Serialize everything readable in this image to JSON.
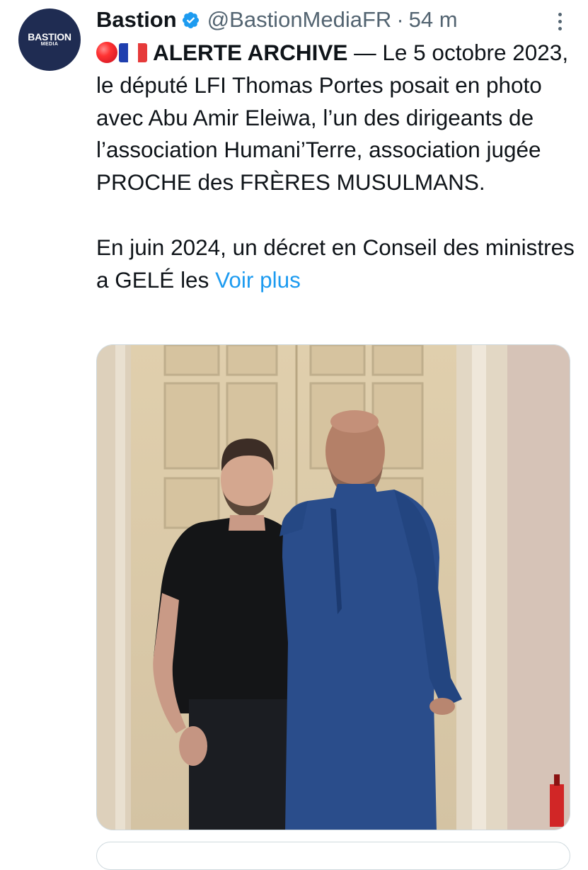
{
  "account": {
    "avatar_line1": "BASTION",
    "avatar_line2": "MEDIA",
    "name": "Bastion",
    "handle": "@BastionMediaFR",
    "separator": "·",
    "time": "54 m"
  },
  "tweet": {
    "headline": "ALERTE ARCHIVE",
    "paragraph1_rest": " — Le 5 octobre 2023, le député LFI Thomas Portes posait en photo avec Abu Amir Eleiwa, l’un des dirigeants de l’association Humani’Terre, association jugée PROCHE des FRÈRES MUSULMANS.",
    "paragraph2": "En juin 2024, un décret en Conseil des ministres a GELÉ les ",
    "show_more": "Voir plus"
  },
  "icons": {
    "verified": "verified-badge-icon",
    "more": "more-options-icon",
    "emoji_1": "red-circle-emoji",
    "emoji_2": "france-flag-emoji"
  },
  "colors": {
    "link": "#1d9bf0",
    "secondary_text": "#536471",
    "verified": "#1d9bf0",
    "avatar_bg": "#1f2c52"
  }
}
